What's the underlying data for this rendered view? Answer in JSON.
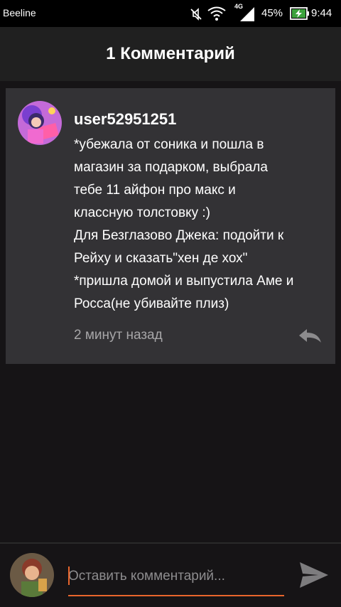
{
  "status_bar": {
    "carrier": "Beeline",
    "network": "4G",
    "battery": "45%",
    "time": "9:44"
  },
  "header": {
    "title": "1 Комментарий"
  },
  "comment": {
    "username": "user52951251",
    "lines": [
      "*убежала от соника и пошла в",
      "магазин за подарком, выбрала",
      "тебе 11 айфон про макс и",
      "классную толстовку :)",
      "Для Безглазово Джека: подойти к",
      "Рейху и сказать\"хен де хох\"",
      "*пришла домой и выпустила Аме и",
      "Росса(не убивайте плиз)"
    ],
    "timestamp": "2 минут назад",
    "reply_icon": "reply-icon"
  },
  "input": {
    "placeholder": "Оставить комментарий...",
    "value": "",
    "send_icon": "send-icon"
  },
  "colors": {
    "accent": "#e8652c",
    "card_bg": "#333235",
    "page_bg": "#161416",
    "header_bg": "#202020",
    "muted_text": "#a7a6a8"
  }
}
